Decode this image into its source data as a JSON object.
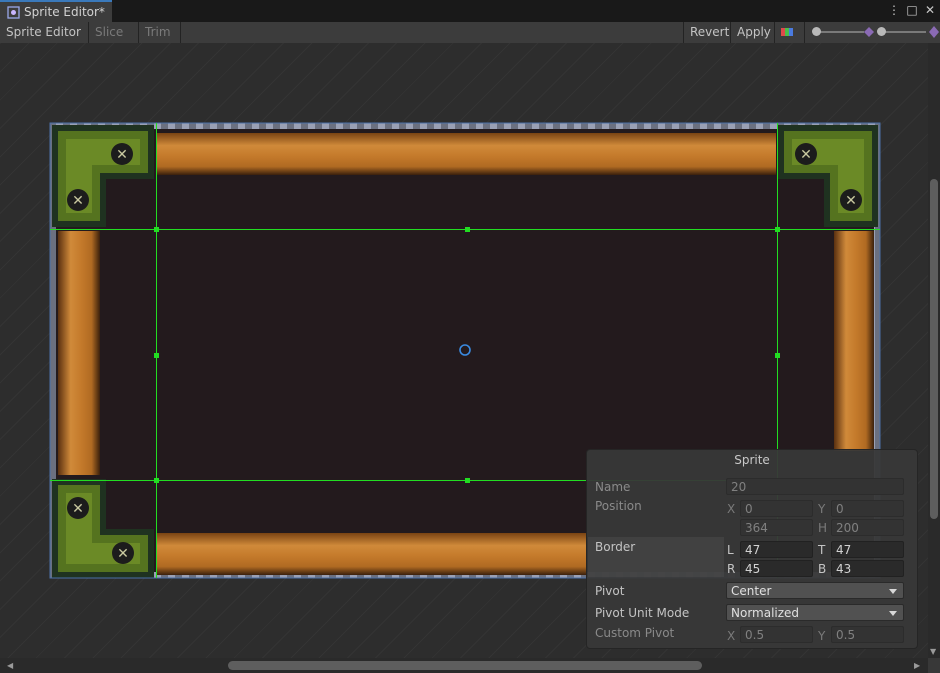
{
  "window": {
    "tab_title": "Sprite Editor*",
    "controls": [
      "⋮",
      "□",
      "✕"
    ]
  },
  "toolbar": {
    "mode_label": "Sprite Editor",
    "slice_label": "Slice",
    "trim_label": "Trim",
    "revert_label": "Revert",
    "apply_label": "Apply"
  },
  "sprite_panel": {
    "title": "Sprite",
    "name_label": "Name",
    "name_value": "20",
    "position_label": "Position",
    "pos_x_axis": "X",
    "pos_x": "0",
    "pos_y_axis": "Y",
    "pos_y": "0",
    "pos_w": "364",
    "pos_h_axis": "H",
    "pos_h": "200",
    "border_label": "Border",
    "border_l_axis": "L",
    "border_l": "47",
    "border_t_axis": "T",
    "border_t": "47",
    "border_r_axis": "R",
    "border_r": "45",
    "border_b_axis": "B",
    "border_b": "43",
    "pivot_label": "Pivot",
    "pivot_value": "Center",
    "pivot_unit_label": "Pivot Unit Mode",
    "pivot_unit_value": "Normalized",
    "custom_pivot_label": "Custom Pivot",
    "custom_x_axis": "X",
    "custom_x": "0.5",
    "custom_y_axis": "Y",
    "custom_y": "0.5"
  },
  "colors": {
    "accent": "#3a79bb",
    "slice_lines": "#22dd22",
    "wood": "#c07a2c",
    "corner_green": "#55731f",
    "sprite_fill": "#231a1d"
  }
}
